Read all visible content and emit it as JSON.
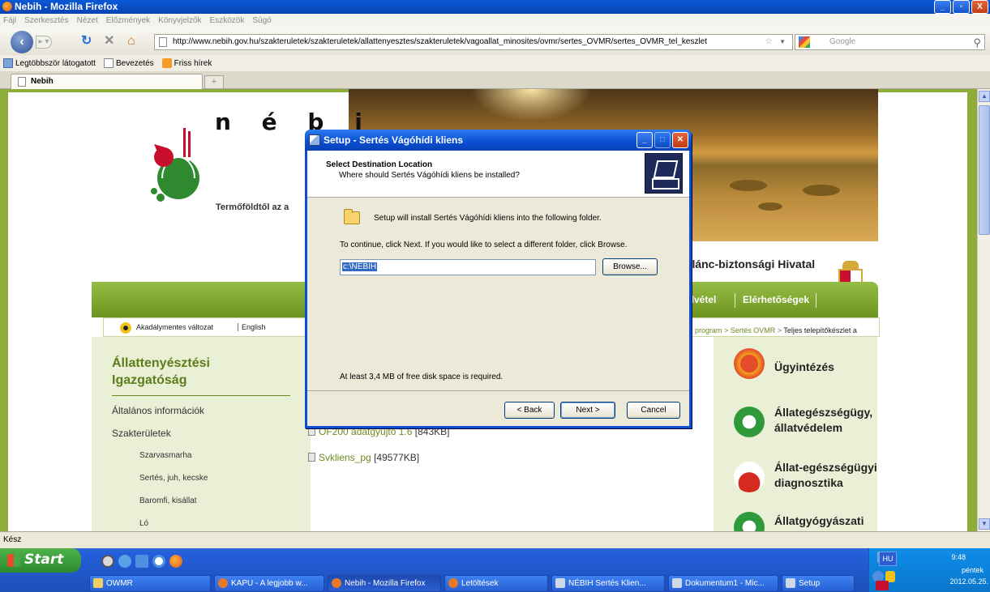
{
  "window": {
    "title": "Nebih - Mozilla Firefox",
    "controls": [
      "_",
      "▫",
      "X"
    ]
  },
  "menu": [
    "Fájl",
    "Szerkesztés",
    "Nézet",
    "Előzmények",
    "Könyvjelzők",
    "Eszközök",
    "Súgó"
  ],
  "navbar": {
    "url": "http://www.nebih.gov.hu/szakteruletek/szakteruletek/allattenyesztes/szakteruletek/vagoallat_minosites/ovmr/sertes_OVMR/sertes_OVMR_tel_keszlet",
    "search_placeholder": "Google"
  },
  "bookmarks": [
    "Legtöbbször látogatott",
    "Bevezetés",
    "Friss hírek"
  ],
  "tab": {
    "title": "Nebih",
    "new_tab": "+"
  },
  "site": {
    "logo_text": "n é b i",
    "tagline": "Termőföldtől az a",
    "org_title": "rlánc-biztonsági Hivatal",
    "nav": [
      "elvétel",
      "Elérhetőségek"
    ],
    "accessibility": "Akadálymentes változat",
    "english": "English",
    "breadcrumb_part": "R program > Sertés OVMR > ",
    "breadcrumb_current": "Teljes telepítőkészlet a",
    "sidebar_title_1": "Állattenyésztési",
    "sidebar_title_2": "Igazgatóság",
    "sidebar_items": [
      "Általános információk",
      "Szakterületek"
    ],
    "sidebar_subitems": [
      "Szarvasmarha",
      "Sertés, juh, kecske",
      "Baromfi, kisállat",
      "Ló"
    ],
    "files": [
      {
        "name": "OF200 adatgyűjtő 1.6",
        "size": "[843KB]"
      },
      {
        "name": "Svkliens_pg",
        "size": "[49577KB]"
      }
    ],
    "right_items": [
      [
        "Ügyintézés"
      ],
      [
        "Állategészségügy,",
        "állatvédelem"
      ],
      [
        "Állat-egészségügyi",
        "diagnosztika"
      ],
      [
        "Állatgyógyászati"
      ]
    ]
  },
  "status": "Kész",
  "dialog": {
    "title": "Setup - Sertés Vágóhídi kliens",
    "heading": "Select Destination Location",
    "subheading": "Where should Sertés Vágóhídi kliens be installed?",
    "install_text": "Setup will install Sertés Vágóhídi kliens into the following folder.",
    "continue_text": "To continue, click Next. If you would like to select a different folder, click Browse.",
    "path": "c:\\NEBIH",
    "browse": "Browse...",
    "disk_space": "At least 3,4 MB of free disk space is required.",
    "back": "< Back",
    "next": "Next >",
    "cancel": "Cancel"
  },
  "taskbar": {
    "start": "Start",
    "tasks": [
      "OWMR",
      "KAPU - A legjobb w...",
      "Nebih - Mozilla Firefox",
      "Letöltések",
      "NÉBIH Sertés Klien...",
      "Dokumentum1 - Mic...",
      "Setup"
    ],
    "lang": "HU",
    "time": "9:48",
    "day": "péntek",
    "date": "2012.05.25."
  }
}
